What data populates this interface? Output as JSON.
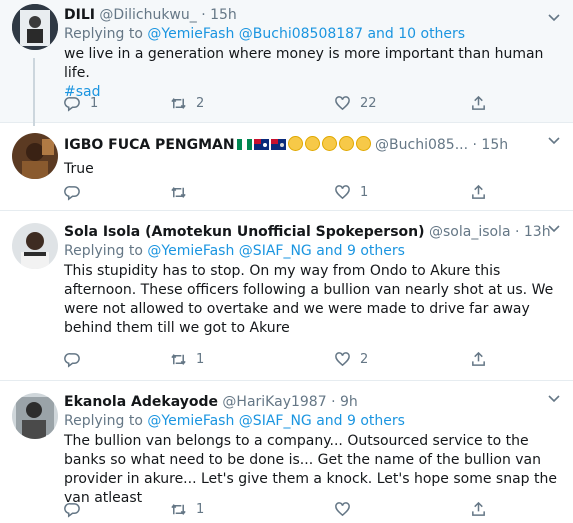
{
  "tweets": [
    {
      "name": "DILI",
      "handle": "@Dilichukwu_",
      "dot": "·",
      "time": "15h",
      "replying_prefix": "Replying to",
      "replying_links": "@YemieFash @Buchi08508187 and 10 others",
      "text": "we live in a generation where money is more important than human life.",
      "hashtag": "#sad",
      "reply_count": "1",
      "retweet_count": "2",
      "like_count": "22"
    },
    {
      "name": "IGBO FUCA PENGMAN",
      "handle": "@Buchi085...",
      "dot": "·",
      "time": "15h",
      "text": "True",
      "reply_count": "",
      "retweet_count": "",
      "like_count": "1"
    },
    {
      "name": "Sola Isola (Amotekun Unofficial Spokeperson)",
      "handle": "@sola_isola",
      "dot": "·",
      "time": "13h",
      "replying_prefix": "Replying to",
      "replying_links": "@YemieFash @SIAF_NG and 9 others",
      "text": "This stupidity has to stop. On my way from Ondo to Akure this afternoon. These officers following a bullion van nearly shot at us. We were not allowed to overtake and we were made to drive far away behind them till we got to Akure",
      "reply_count": "",
      "retweet_count": "1",
      "like_count": "2"
    },
    {
      "name": "Ekanola Adekayode",
      "handle": "@HariKay1987",
      "dot": "·",
      "time": "9h",
      "replying_prefix": "Replying to",
      "replying_links": "@YemieFash @SIAF_NG and 9 others",
      "text": "The bullion van belongs to a company... Outsourced service to the banks so what need to be done is... Get the name of the bullion van provider in akure... Let's give them a knock. Let's hope some snap the van atleast",
      "reply_count": "",
      "retweet_count": "1",
      "like_count": ""
    }
  ],
  "icons": [
    "reply-icon",
    "retweet-icon",
    "like-icon",
    "share-icon",
    "chevron-down-icon"
  ],
  "colors": {
    "link": "#1b95e0",
    "muted": "#657786",
    "highlight_bg": "#f5f8fa"
  }
}
